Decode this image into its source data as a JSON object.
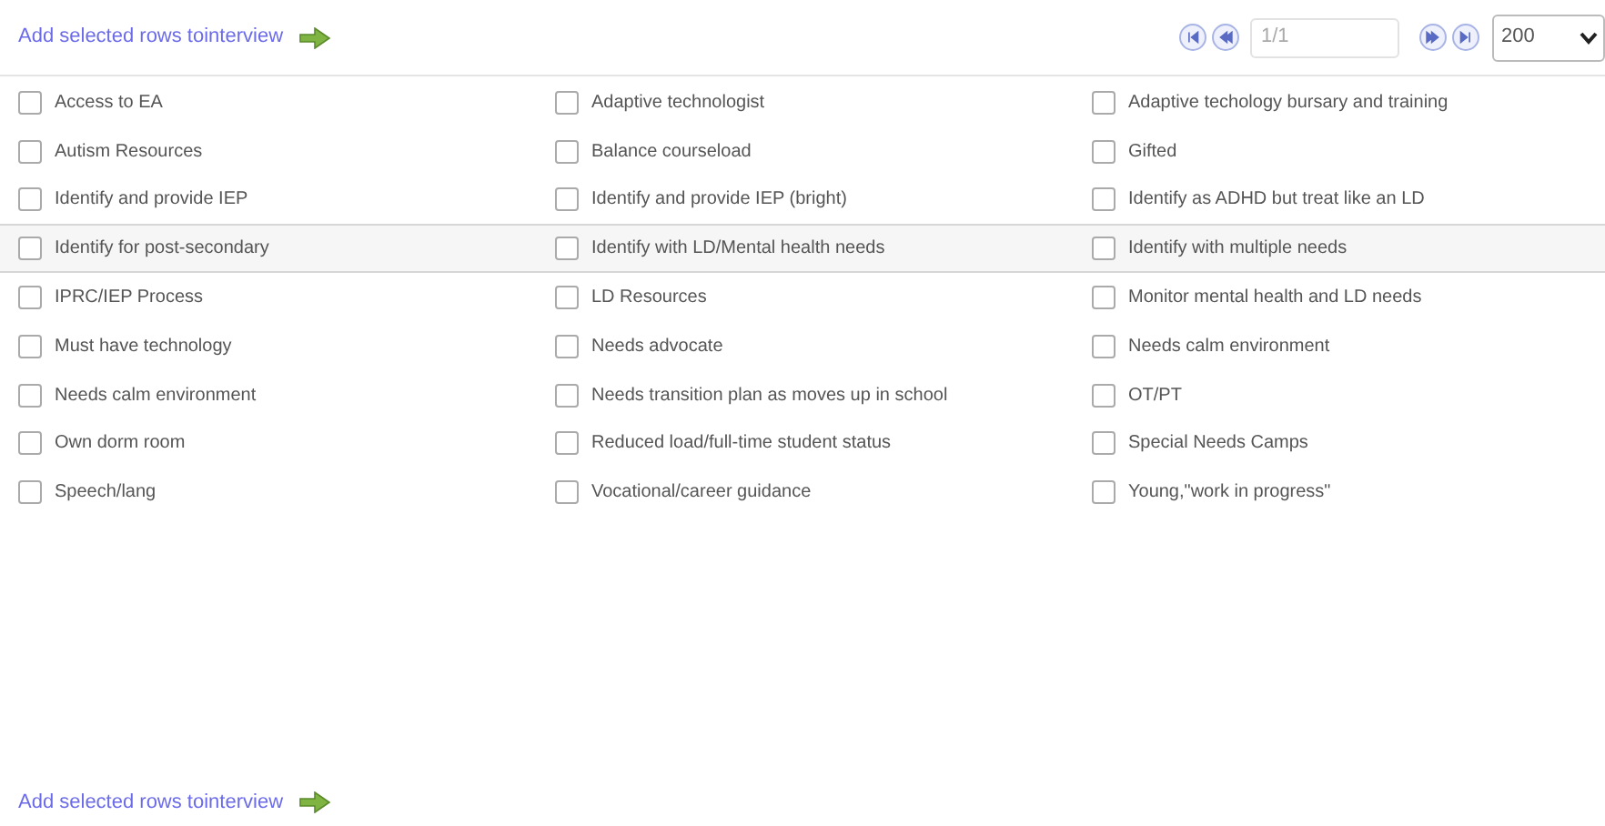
{
  "top_action": {
    "label": "Add selected rows tointerview"
  },
  "pager": {
    "page": "1/1",
    "page_size": "200"
  },
  "rows": [
    {
      "highlighted": false,
      "items": [
        {
          "label": "Access to EA",
          "checked": false
        },
        {
          "label": "Adaptive technologist",
          "checked": false
        },
        {
          "label": "Adaptive techology bursary and training",
          "checked": false
        }
      ]
    },
    {
      "highlighted": false,
      "items": [
        {
          "label": "Autism Resources",
          "checked": false
        },
        {
          "label": "Balance courseload",
          "checked": false
        },
        {
          "label": "Gifted",
          "checked": false
        }
      ]
    },
    {
      "highlighted": false,
      "items": [
        {
          "label": "Identify and provide IEP",
          "checked": false
        },
        {
          "label": "Identify and provide IEP (bright)",
          "checked": false
        },
        {
          "label": "Identify as ADHD but treat like an LD",
          "checked": false
        }
      ]
    },
    {
      "highlighted": true,
      "items": [
        {
          "label": "Identify for post-secondary",
          "checked": false
        },
        {
          "label": "Identify with LD/Mental health needs",
          "checked": false
        },
        {
          "label": "Identify with multiple needs",
          "checked": false
        }
      ]
    },
    {
      "highlighted": false,
      "items": [
        {
          "label": "IPRC/IEP Process",
          "checked": false
        },
        {
          "label": "LD Resources",
          "checked": false
        },
        {
          "label": "Monitor mental health and LD needs",
          "checked": false
        }
      ]
    },
    {
      "highlighted": false,
      "items": [
        {
          "label": "Must have technology",
          "checked": false
        },
        {
          "label": "Needs advocate",
          "checked": false
        },
        {
          "label": "Needs calm environment",
          "checked": false
        }
      ]
    },
    {
      "highlighted": false,
      "items": [
        {
          "label": "Needs calm environment",
          "checked": false
        },
        {
          "label": "Needs transition plan as moves up in school",
          "checked": false
        },
        {
          "label": "OT/PT",
          "checked": false
        }
      ]
    },
    {
      "highlighted": false,
      "items": [
        {
          "label": "Own dorm room",
          "checked": false
        },
        {
          "label": "Reduced load/full-time student status",
          "checked": false
        },
        {
          "label": "Special Needs Camps",
          "checked": false
        }
      ]
    },
    {
      "highlighted": false,
      "items": [
        {
          "label": "Speech/lang",
          "checked": false
        },
        {
          "label": "Vocational/career guidance",
          "checked": false
        },
        {
          "label": "Young,\"work in progress\"",
          "checked": false
        }
      ]
    }
  ],
  "bottom_action": {
    "label": "Add selected rows tointerview"
  }
}
